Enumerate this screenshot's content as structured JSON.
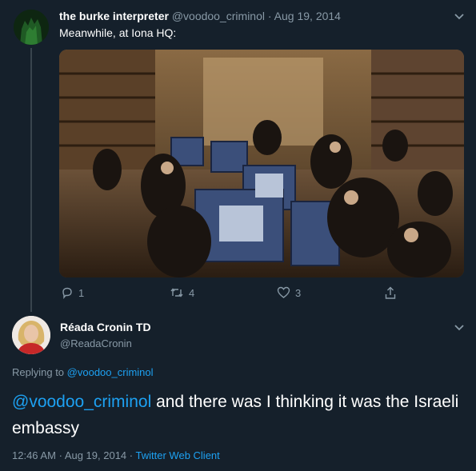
{
  "tweet": {
    "display_name": "the burke interpreter",
    "handle": "@voodoo_criminol",
    "separator": "·",
    "date": "Aug 19, 2014",
    "text": "Meanwhile, at Iona HQ:",
    "media_icon": "photo-chimpanzees-at-computers",
    "actions": {
      "reply_icon": "reply-icon",
      "reply_count": "1",
      "retweet_icon": "retweet-icon",
      "retweet_count": "4",
      "like_icon": "heart-icon",
      "like_count": "3",
      "share_icon": "share-icon"
    }
  },
  "reply": {
    "display_name": "Réada Cronin TD",
    "handle": "@ReadaCronin",
    "replying_prefix": "Replying to",
    "replying_to": "@voodoo_criminol",
    "mention": "@voodoo_criminol",
    "text": "and there was I thinking it was the Israeli embassy",
    "time": "12:46 AM",
    "dot": "·",
    "date": "Aug 19, 2014",
    "client": "Twitter Web Client"
  },
  "colors": {
    "background": "#15202b",
    "secondary_text": "#8899a6",
    "link": "#1da1f2",
    "divider": "#38444d"
  }
}
